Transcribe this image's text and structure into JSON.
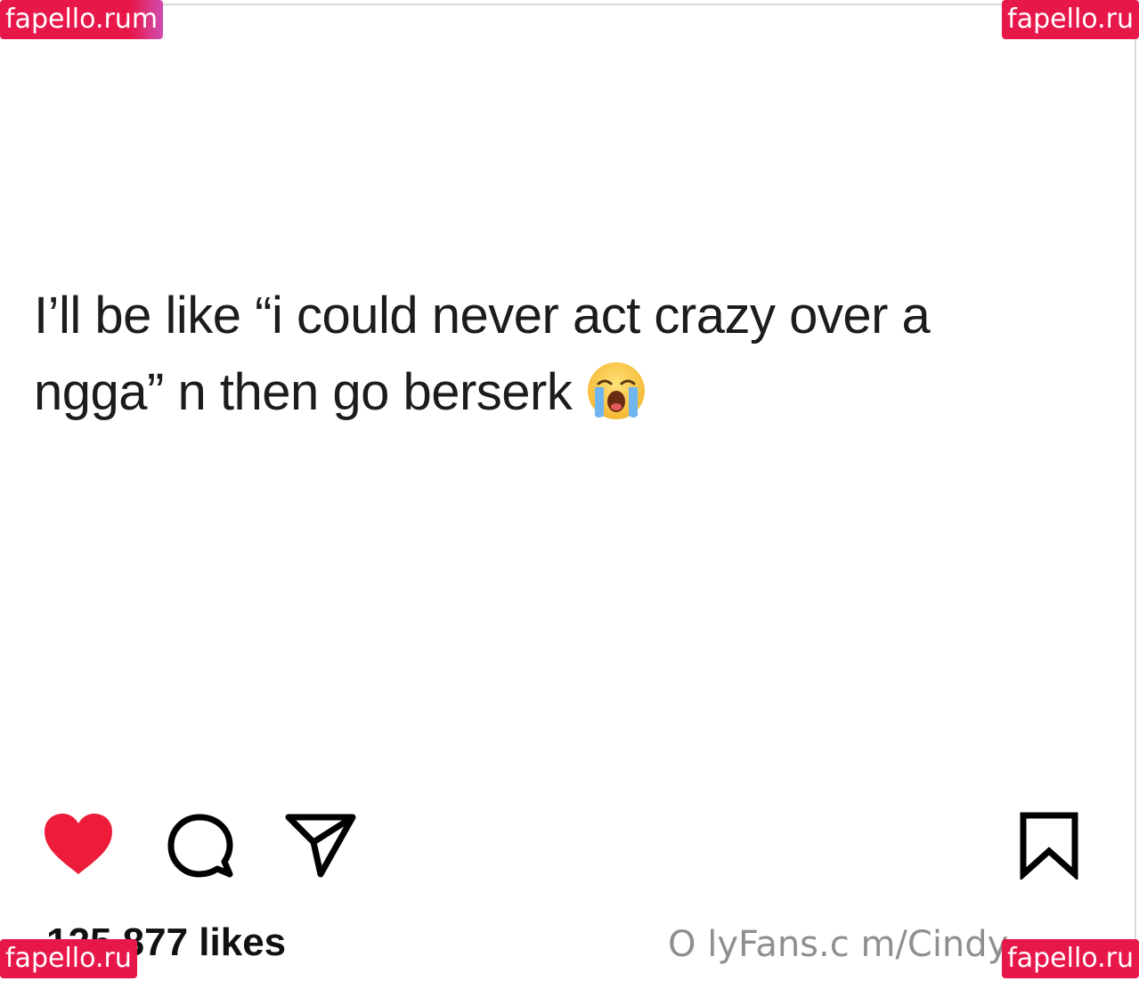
{
  "post": {
    "line1": "I’ll be like “i could never act crazy over a",
    "line2": "ngga” n then go berserk",
    "emoji_icon": "loudly-crying-face-emoji"
  },
  "actions": {
    "like_icon": "heart-filled-icon",
    "comment_icon": "comment-bubble-icon",
    "share_icon": "paper-plane-icon",
    "save_icon": "bookmark-icon",
    "like_color": "#ed1c3a"
  },
  "likes_text": "125,877 likes",
  "overlay_url": "O lyFans.c m/Cindy",
  "watermarks": {
    "top_left": "fapello.rum",
    "top_right": "fapello.ru",
    "bottom_left": "fapello.ru",
    "bottom_right": "fapello.ru",
    "color": "#e8174a"
  }
}
